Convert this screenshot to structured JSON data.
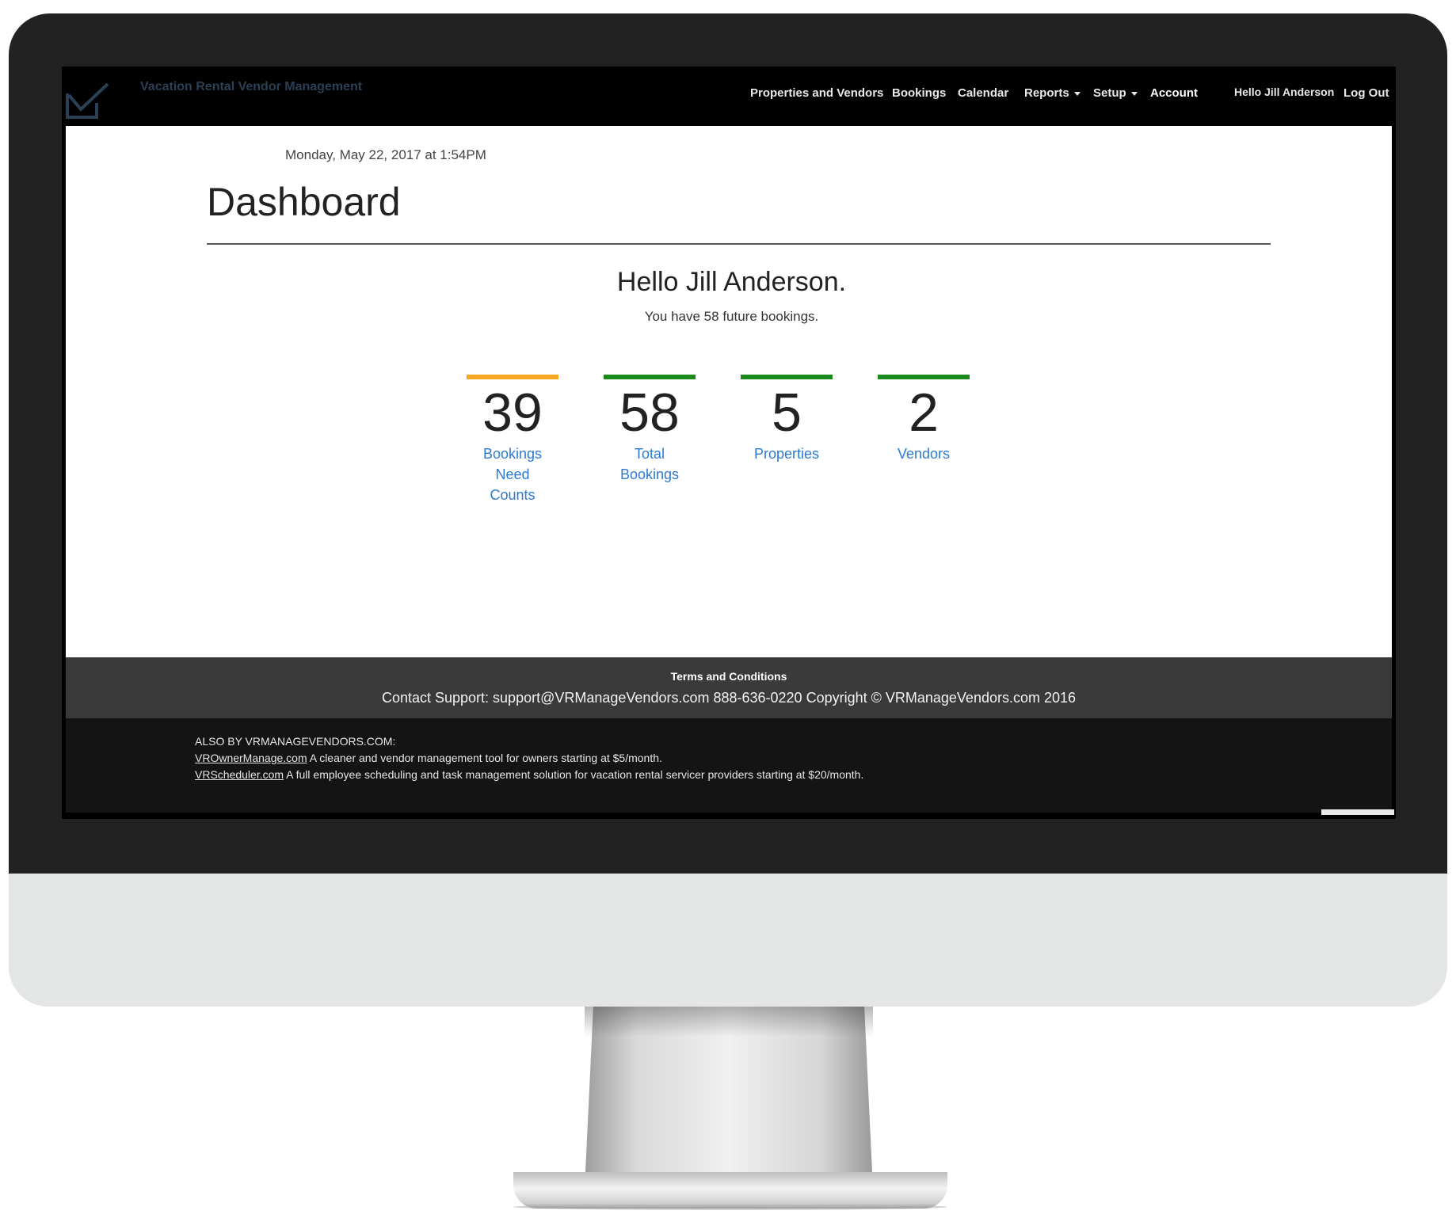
{
  "brand": {
    "title": "Vacation Rental Vendor Management",
    "logo_icon": "checkmark-envelope-icon",
    "logo_color": "#2b3f55"
  },
  "nav": {
    "items": [
      {
        "label": "Properties and Vendors"
      },
      {
        "label": "Bookings"
      },
      {
        "label": "Calendar"
      },
      {
        "label": "Reports",
        "dropdown": true
      },
      {
        "label": "Setup",
        "dropdown": true
      },
      {
        "label": "Account",
        "active": true
      }
    ],
    "user_greeting": "Hello Jill Anderson",
    "logout": "Log Out"
  },
  "page": {
    "datetime": "Monday, May 22, 2017 at 1:54PM",
    "title": "Dashboard",
    "greeting": "Hello Jill Anderson.",
    "subgreeting": "You have 58 future bookings."
  },
  "stats": [
    {
      "value": "39",
      "label_lines": [
        "Bookings",
        "Need",
        "Counts"
      ],
      "color": "#f5a623"
    },
    {
      "value": "58",
      "label_lines": [
        "Total",
        "Bookings"
      ],
      "color": "#1a8a1a"
    },
    {
      "value": "5",
      "label_lines": [
        "Properties"
      ],
      "color": "#1a8a1a"
    },
    {
      "value": "2",
      "label_lines": [
        "Vendors"
      ],
      "color": "#1a8a1a"
    }
  ],
  "footer": {
    "terms": "Terms and Conditions",
    "contact": "Contact Support: support@VRManageVendors.com 888-636-0220 Copyright © VRManageVendors.com 2016"
  },
  "also_by": {
    "heading": "ALSO BY VRMANAGEVENDORS.COM:",
    "products": [
      {
        "link": "VROwnerManage.com",
        "text": " A cleaner and vendor management tool for owners starting at $5/month."
      },
      {
        "link": "VRScheduler.com",
        "text": " A full employee scheduling and task management solution for vacation rental servicer providers starting at $20/month."
      }
    ]
  },
  "colors": {
    "link_blue": "#2c7bd3",
    "navbar_bg": "#000000",
    "footer_gray": "#3a3a3a",
    "footer_dark": "#141414"
  }
}
